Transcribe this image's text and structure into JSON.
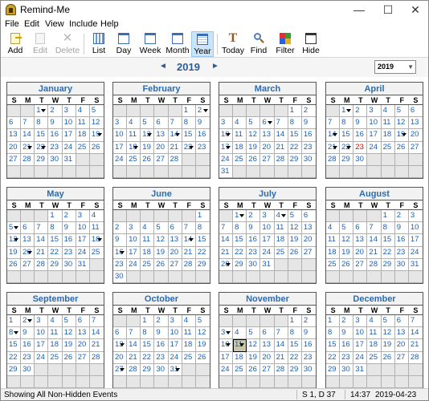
{
  "window": {
    "title": "Remind-Me",
    "minimize": "—",
    "maximize": "☐",
    "close": "✕"
  },
  "menu": [
    "File",
    "Edit",
    "View",
    "Include",
    "Help"
  ],
  "toolbar": {
    "add": "Add",
    "edit": "Edit",
    "delete": "Delete",
    "list": "List",
    "day": "Day",
    "week": "Week",
    "month": "Month",
    "year": "Year",
    "today": "Today",
    "find": "Find",
    "filter": "Filter",
    "hide": "Hide",
    "selected": "Year",
    "disabled": [
      "Edit",
      "Delete"
    ]
  },
  "nav": {
    "prev": "◄",
    "year": "2019",
    "next": "►",
    "combo": "2019"
  },
  "weekdays": [
    "S",
    "M",
    "T",
    "W",
    "T",
    "F",
    "S"
  ],
  "months": [
    {
      "name": "January",
      "start": 2,
      "days": 31,
      "events": [
        1,
        19,
        21,
        22
      ],
      "red": []
    },
    {
      "name": "February",
      "start": 5,
      "days": 28,
      "events": [
        2,
        12,
        14,
        18,
        22
      ],
      "red": []
    },
    {
      "name": "March",
      "start": 5,
      "days": 31,
      "events": [
        6,
        10,
        17
      ],
      "red": []
    },
    {
      "name": "April",
      "start": 1,
      "days": 30,
      "events": [
        1,
        14,
        19,
        21,
        22
      ],
      "red": [
        23
      ]
    },
    {
      "name": "May",
      "start": 3,
      "days": 31,
      "events": [
        5,
        12,
        18,
        20
      ],
      "red": []
    },
    {
      "name": "June",
      "start": 6,
      "days": 30,
      "events": [
        14,
        16
      ],
      "red": []
    },
    {
      "name": "July",
      "start": 1,
      "days": 31,
      "events": [
        1,
        4,
        28
      ],
      "red": []
    },
    {
      "name": "August",
      "start": 4,
      "days": 31,
      "events": [],
      "red": []
    },
    {
      "name": "September",
      "start": 0,
      "days": 30,
      "events": [
        2,
        8
      ],
      "red": []
    },
    {
      "name": "October",
      "start": 2,
      "days": 31,
      "events": [
        13,
        27,
        31
      ],
      "red": []
    },
    {
      "name": "November",
      "start": 5,
      "days": 30,
      "events": [
        3,
        10,
        11
      ],
      "red": [],
      "selected": 11
    },
    {
      "name": "December",
      "start": 0,
      "days": 31,
      "events": [],
      "red": []
    }
  ],
  "status": {
    "left": "Showing All Non-Hidden Events",
    "pos": "S 1, D 37",
    "time": "14:37",
    "date": "2019-04-23"
  },
  "colors": {
    "accent": "#2b6cb0",
    "today": "#dd0000",
    "selection": "#cce4f7"
  }
}
